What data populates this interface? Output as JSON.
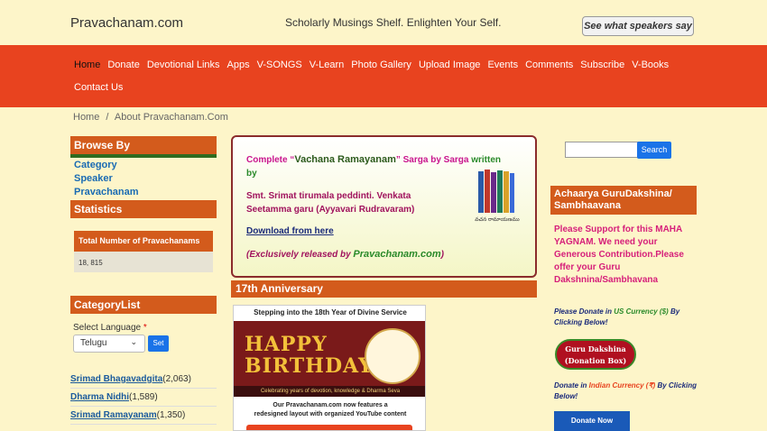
{
  "header": {
    "site_name": "Pravachanam.com",
    "tagline": "Scholarly Musings Shelf. Enlighten Your Self.",
    "speakers_button": "See what speakers say"
  },
  "nav": {
    "row1": [
      "Home",
      "Donate",
      "Devotional Links",
      "Apps",
      "V-SONGS",
      "V-Learn",
      "Photo Gallery",
      "Upload Image",
      "Events",
      "Comments",
      "Subscribe",
      "V-Books"
    ],
    "row2": [
      "Contact Us"
    ],
    "active": "Home"
  },
  "breadcrumb": {
    "home": "Home",
    "sep": "/",
    "current": "About Pravachanam.Com"
  },
  "sidebar": {
    "browse_by": "Browse By",
    "browse_links": [
      "Category",
      "Speaker",
      "Pravachanam"
    ],
    "statistics": "Statistics",
    "stats_label": "Total Number of Pravachanams",
    "stats_value": "18, 815",
    "category_list": "CategoryList",
    "select_language_label": "Select Language",
    "required_mark": "*",
    "language_value": "Telugu",
    "set_button": "Set",
    "categories": [
      {
        "name": "Srimad Bhagavadgita",
        "count": "(2,063)"
      },
      {
        "name": "Dharma Nidhi",
        "count": "(1,589)"
      },
      {
        "name": "Srimad Ramayanam",
        "count": "(1,350)"
      }
    ]
  },
  "feature": {
    "title_pre": "Complete “",
    "title_name": "Vachana Ramayanam",
    "title_mid": "” Sarga by Sarga ",
    "title_written": "written",
    "title_by": "by",
    "author": "Smt. Srimat tirumala peddinti. Venkata Seetamma garu (Ayyavari Rudravaram)",
    "download": "Download from here",
    "excl_pre": "(Exclusively released by ",
    "excl_brand": "Pravachanam.com",
    "excl_post": ")",
    "book_caption": "వచన రామాయణము"
  },
  "anniversary": {
    "heading": "17th Anniversary",
    "poster_top": "Stepping into the 18th Year of Divine Service",
    "happy": "HAPPY",
    "birthday": "BIRTHDAY",
    "strip": "Celebrating years of devotion, knowledge & Dharma Seva",
    "text_line1": "Our Pravachanam.com now features a",
    "text_line2": "redesigned layout with organized YouTube content"
  },
  "right": {
    "search_button": "Search",
    "search_placeholder": "",
    "heading": "Achaarya GuruDakshina/ Sambhaavana",
    "support_text": "Please Support for this MAHA YAGNAM. We need your Generous Contribution.Please offer your Guru Dakshnina/Sambhavana",
    "donate_us_pre": "Please Donate in ",
    "donate_us_cur": "US Currency ($)",
    "donate_us_post": " By Clicking Below!",
    "gd_line1": "Guru Dakshina",
    "gd_line2": "(Donation Box)",
    "donate_in_pre": "Donate in ",
    "donate_in_cur": "Indian Currency (₹)",
    "donate_in_post": " By Clicking Below!",
    "donate_now": "Donate Now"
  }
}
